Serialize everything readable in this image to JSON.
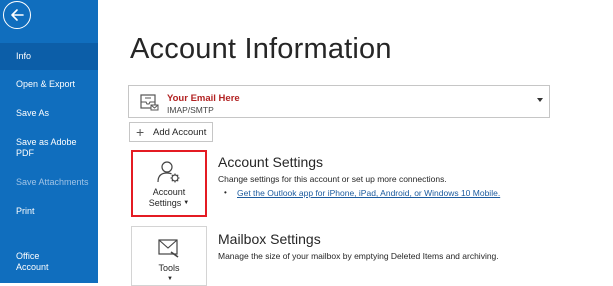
{
  "sidebar": {
    "items": [
      {
        "label": "Info",
        "active": true
      },
      {
        "label": "Open & Export"
      },
      {
        "label": "Save As"
      },
      {
        "label": "Save as Adobe PDF"
      },
      {
        "label": "Save Attachments",
        "disabled": true
      },
      {
        "label": "Print"
      },
      {
        "label": "Office Account"
      }
    ],
    "bg_color": "#106ebe",
    "active_color": "#0c5ea8"
  },
  "main": {
    "title": "Account Information",
    "account": {
      "email": "Your Email Here",
      "type": "IMAP/SMTP",
      "icon": "mailbox-icon"
    },
    "add_account_label": "Add Account",
    "account_settings": {
      "button_line1": "Account",
      "button_line2": "Settings",
      "title": "Account Settings",
      "description": "Change settings for this account or set up more connections.",
      "link": "Get the Outlook app for iPhone, iPad, Android, or Windows 10 Mobile."
    },
    "mailbox_settings": {
      "button_label": "Tools",
      "title": "Mailbox Settings",
      "description": "Manage the size of your mailbox by emptying Deleted Items and archiving."
    }
  },
  "colors": {
    "highlight_border": "#e41b23",
    "link": "#1c5b9e",
    "email": "#b22222"
  }
}
